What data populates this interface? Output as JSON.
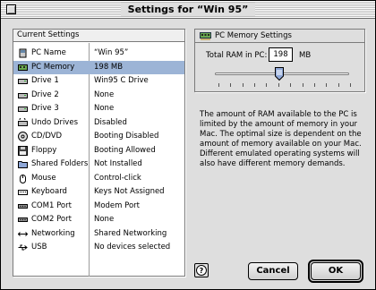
{
  "window": {
    "title": "Settings for “Win 95”"
  },
  "list": {
    "header": "Current Settings",
    "rows": [
      {
        "name": "PC Name",
        "value": "“Win 95”",
        "icon": "pc-name-icon"
      },
      {
        "name": "PC Memory",
        "value": "198 MB",
        "icon": "memory-chip-icon",
        "selected": true
      },
      {
        "name": "Drive 1",
        "value": "Win95 C Drive",
        "icon": "drive-icon"
      },
      {
        "name": "Drive 2",
        "value": "None",
        "icon": "drive-icon"
      },
      {
        "name": "Drive 3",
        "value": "None",
        "icon": "drive-icon"
      },
      {
        "name": "Undo Drives",
        "value": "Disabled",
        "icon": "undo-drive-icon"
      },
      {
        "name": "CD/DVD",
        "value": "Booting Disabled",
        "icon": "cd-icon"
      },
      {
        "name": "Floppy",
        "value": "Booting Allowed",
        "icon": "floppy-icon"
      },
      {
        "name": "Shared Folders",
        "value": "Not Installed",
        "icon": "folder-icon"
      },
      {
        "name": "Mouse",
        "value": "Control-click",
        "icon": "mouse-icon"
      },
      {
        "name": "Keyboard",
        "value": "Keys Not Assigned",
        "icon": "keyboard-icon"
      },
      {
        "name": "COM1 Port",
        "value": "Modem Port",
        "icon": "port-icon"
      },
      {
        "name": "COM2 Port",
        "value": "None",
        "icon": "port-icon"
      },
      {
        "name": "Networking",
        "value": "Shared Networking",
        "icon": "network-icon"
      },
      {
        "name": "USB",
        "value": "No devices selected",
        "icon": "usb-icon"
      }
    ]
  },
  "memory_panel": {
    "title": "PC Memory Settings",
    "ram_label": "Total RAM in PC:",
    "ram_value": "198",
    "ram_unit": "MB",
    "slider_fraction": 0.48,
    "tick_count": 12
  },
  "description": "The amount of RAM available to the PC is limited by the amount of memory in your Mac. The optimal size is dependent on the amount of memory available on your Mac. Different emulated operating systems will also have different memory demands.",
  "buttons": {
    "help": "?",
    "cancel": "Cancel",
    "ok": "OK"
  },
  "colors": {
    "selection": "#9cb4d6",
    "window_bg": "#dedede"
  }
}
